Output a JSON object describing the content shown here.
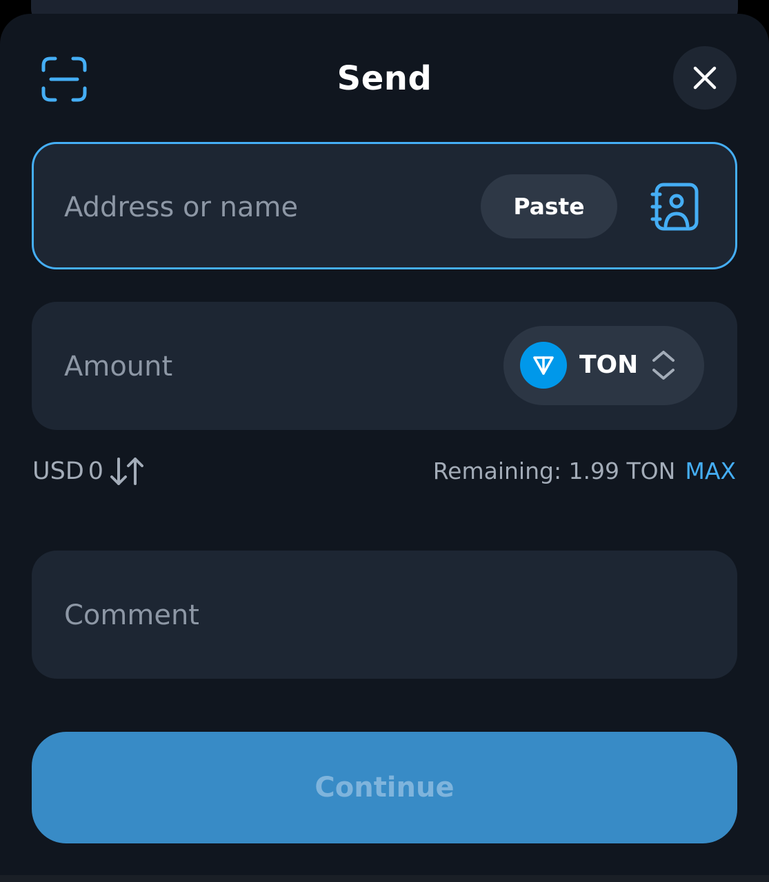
{
  "header": {
    "title": "Send",
    "scan_icon": "qr-scan-icon",
    "close_icon": "close-icon"
  },
  "address": {
    "placeholder": "Address or name",
    "value": "",
    "paste_label": "Paste",
    "contacts_icon": "address-book-icon"
  },
  "amount": {
    "placeholder": "Amount",
    "value": "",
    "token": {
      "symbol": "TON",
      "icon": "ton-logo-icon",
      "selector_icon": "chevron-up-down-icon"
    }
  },
  "balance": {
    "fiat_currency": "USD",
    "fiat_value": "0",
    "swap_icon": "swap-arrows-icon",
    "remaining_text": "Remaining: 1.99 TON",
    "max_label": "MAX"
  },
  "comment": {
    "placeholder": "Comment",
    "value": ""
  },
  "footer": {
    "continue_label": "Continue"
  },
  "colors": {
    "accent": "#45aef5",
    "sheet_background": "#10161f",
    "field_background": "#1d2633",
    "pill_background": "#2e3846",
    "ton_blue": "#0098ea",
    "continue_button": "#388bc6",
    "continue_text_disabled": "#7fb4dc",
    "secondary_text": "#a3acb8"
  }
}
